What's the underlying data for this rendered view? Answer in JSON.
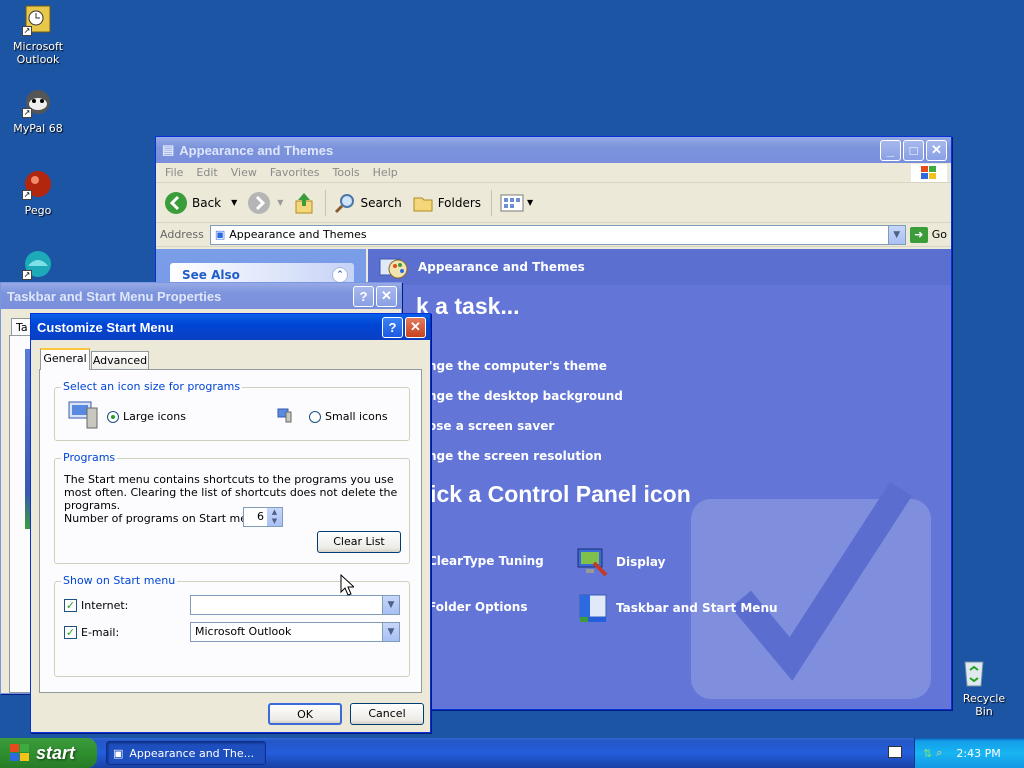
{
  "desktop": {
    "icons": [
      {
        "label": "Microsoft Outlook"
      },
      {
        "label": "MyPal 68"
      },
      {
        "label": "Pego"
      },
      {
        "label": ""
      },
      {
        "label": "Recycle Bin"
      }
    ]
  },
  "explorer": {
    "title": "Appearance and Themes",
    "menu": [
      "File",
      "Edit",
      "View",
      "Favorites",
      "Tools",
      "Help"
    ],
    "toolbar": {
      "back": "Back",
      "search": "Search",
      "folders": "Folders"
    },
    "address": {
      "label": "Address",
      "value": "Appearance and Themes",
      "go": "Go"
    },
    "see_also": "See Also",
    "header": "Appearance and Themes",
    "pick_task": "k a task...",
    "tasks": [
      "nge the computer's theme",
      "nge the desktop background",
      "ose a screen saver",
      "nge the screen resolution"
    ],
    "pick_icon": "pick a Control Panel icon",
    "icons": [
      "ClearType Tuning",
      "Display",
      "Folder Options",
      "Taskbar and Start Menu"
    ]
  },
  "taskbar_props": {
    "title": "Taskbar and Start Menu Properties",
    "tab_partial": "Ta"
  },
  "customize": {
    "title": "Customize Start Menu",
    "tabs": [
      "General",
      "Advanced"
    ],
    "icon_size": {
      "legend": "Select an icon size for programs",
      "large": "Large icons",
      "small": "Small icons"
    },
    "programs": {
      "legend": "Programs",
      "description": "The Start menu contains shortcuts to the programs you use most often. Clearing the list of shortcuts does not delete the programs.",
      "count_label": "Number of programs on Start menu:",
      "count_value": "6",
      "clear_button": "Clear List"
    },
    "show": {
      "legend": "Show on Start menu",
      "internet_label": "Internet:",
      "internet_value": "",
      "email_label": "E-mail:",
      "email_value": "Microsoft Outlook"
    },
    "ok": "OK",
    "cancel": "Cancel"
  },
  "taskbar": {
    "start": "start",
    "task_item": "Appearance and The...",
    "clock": "2:43 PM"
  },
  "colors": {
    "desktop": "#1c55a4",
    "title_active": "#0046d5",
    "control_panel": "#6375d6",
    "taskbar": "#245edb",
    "start": "#2f8f2f"
  }
}
